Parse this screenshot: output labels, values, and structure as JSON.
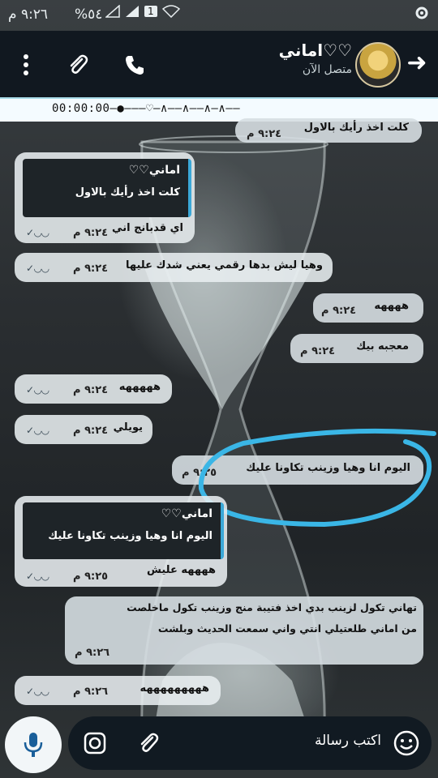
{
  "status": {
    "time": "٩:٢٦ م",
    "battery": "%٥٤",
    "sim": "1"
  },
  "header": {
    "contact_name": "اماني♡♡",
    "status": "متصل الآن"
  },
  "strip": "00:00:00—●———♡—∧——∧——∧—∧——",
  "messages": [
    {
      "text": "كلت اخذ رأيك بالاول",
      "time": "٩:٢٤ م"
    },
    {
      "quote_name": "اماني♡♡",
      "quote_text": "كلت اخذ رأيك بالاول",
      "text": "اي قدبانج اني",
      "time": "٩:٢٤ م"
    },
    {
      "text": "وهيا ليش بدها رقمي يعني شدك عليها",
      "time": "٩:٢٤ م"
    },
    {
      "text": "ههههه",
      "time": "٩:٢٤ م"
    },
    {
      "text": "معجبه بيك",
      "time": "٩:٢٤ م"
    },
    {
      "text": "هههههه",
      "time": "٩:٢٤ م"
    },
    {
      "text": "يويلي",
      "time": "٩:٢٤ م"
    },
    {
      "text": "اليوم انا وهيا وزينب تكاونا عليك",
      "time": "٩:٢٥ م"
    },
    {
      "quote_name": "اماني♡♡",
      "quote_text": "اليوم انا وهيا وزينب تكاونا عليك",
      "text": "ههههه عليش",
      "time": "٩:٢٥ م"
    },
    {
      "line1": "تهاني تكول لزينب بدي اخذ فتيبة منج وزينب تكول ماخلصت",
      "line2": "من اماني طلعتيلي انتي واني سمعت الحديث وبلشت",
      "time": "٩:٢٦ م"
    },
    {
      "text": "هههههههههه",
      "time": "٩:٢٦ م"
    }
  ],
  "input": {
    "placeholder": "اكتب رسالة"
  },
  "colors": {
    "accent": "#3ab6e6",
    "appbar": "#111820"
  }
}
